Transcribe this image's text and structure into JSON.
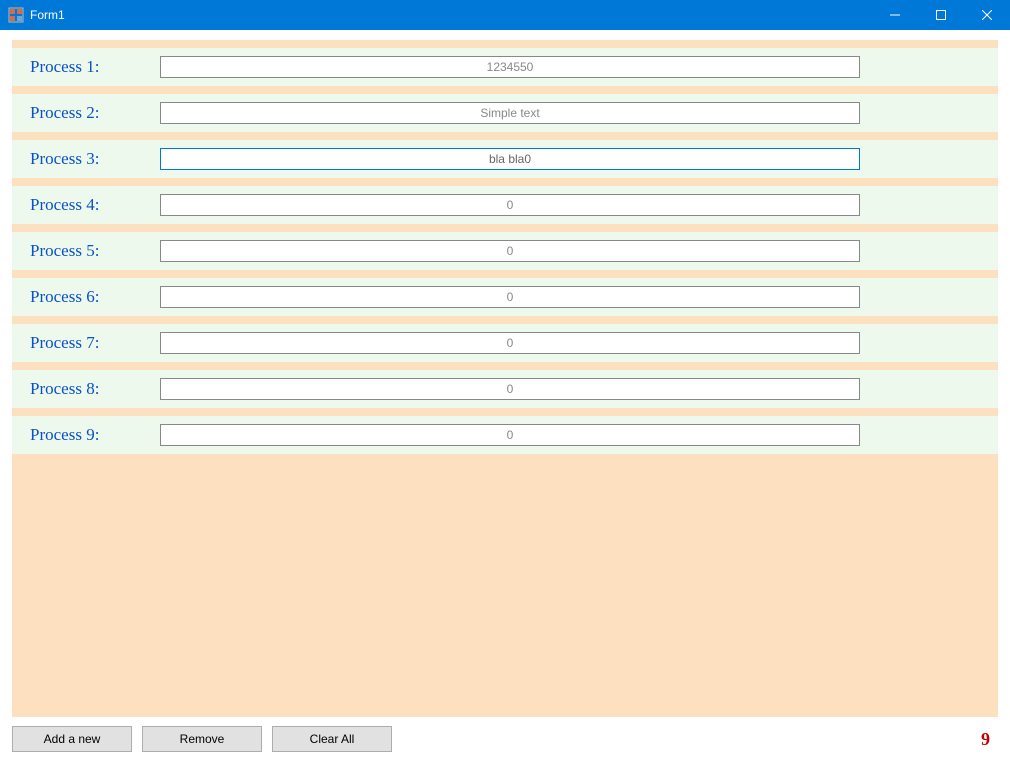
{
  "window": {
    "title": "Form1"
  },
  "processes": [
    {
      "label": "Process 1:",
      "value": "1234550",
      "active": false
    },
    {
      "label": "Process 2:",
      "value": "Simple text",
      "active": false
    },
    {
      "label": "Process 3:",
      "value": "bla bla0",
      "active": true
    },
    {
      "label": "Process 4:",
      "value": "0",
      "active": false
    },
    {
      "label": "Process 5:",
      "value": "0",
      "active": false
    },
    {
      "label": "Process 6:",
      "value": "0",
      "active": false
    },
    {
      "label": "Process 7:",
      "value": "0",
      "active": false
    },
    {
      "label": "Process 8:",
      "value": "0",
      "active": false
    },
    {
      "label": "Process 9:",
      "value": "0",
      "active": false
    }
  ],
  "buttons": {
    "add": "Add a new",
    "remove": "Remove",
    "clear": "Clear All"
  },
  "counter": "9"
}
